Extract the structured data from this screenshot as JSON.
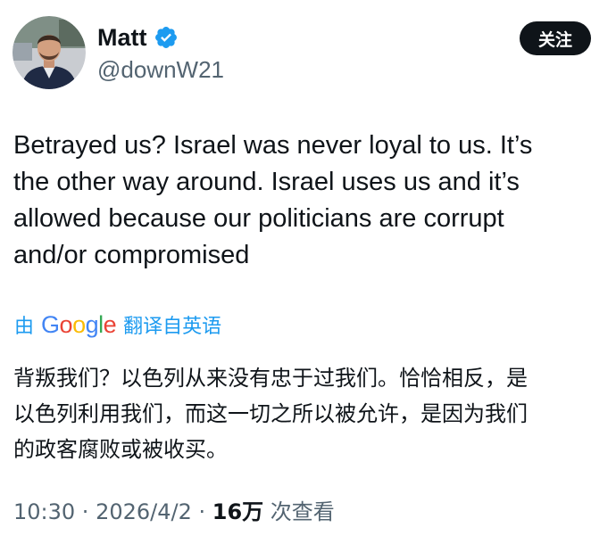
{
  "author": {
    "display_name": "Matt",
    "handle": "@downW21",
    "verified": true,
    "avatar_icon": "profile-photo"
  },
  "follow_button": {
    "label": "关注"
  },
  "tweet": {
    "lines": [
      "Betrayed us? Israel was never loyal to us.  It’s",
      "the other way around.  Israel uses us and it’s",
      "allowed because our politicians are corrupt",
      "and/or compromised"
    ]
  },
  "translate": {
    "prefix": "由",
    "provider": [
      "G",
      "o",
      "o",
      "g",
      "l",
      "e"
    ],
    "suffix": "翻译自英语"
  },
  "translation": {
    "lines": [
      "背叛我们？以色列从来没有忠于过我们。恰恰相反，是",
      "以色列利用我们，而这一切之所以被允许，是因为我们",
      "的政客腐败或被收买。"
    ]
  },
  "meta": {
    "time": "10:30",
    "sep1": " · ",
    "date": "2026/4/2",
    "sep2": " · ",
    "views": "16万",
    "views_label": " 次查看"
  },
  "colors": {
    "verified_badge": "#1d9bf0",
    "link": "#1d9bf0",
    "secondary_text": "#536471",
    "follow_bg": "#0f1419"
  }
}
